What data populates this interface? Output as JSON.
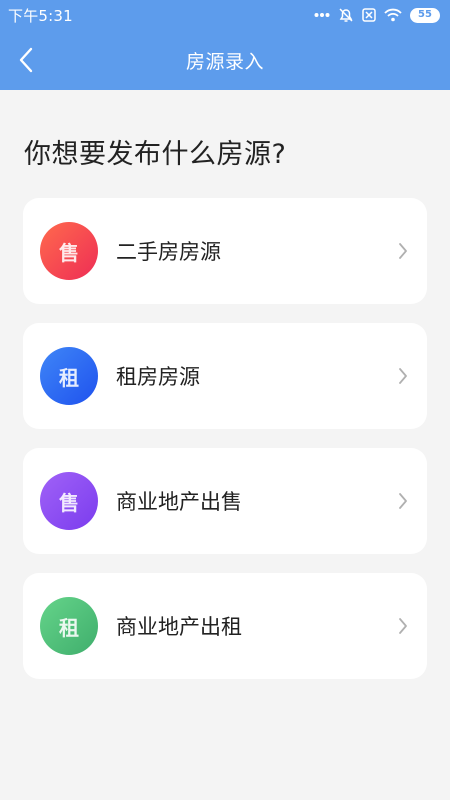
{
  "status_bar": {
    "time": "下午5:31",
    "battery": "55",
    "icons": [
      "more-dots-icon",
      "mute-icon",
      "no-sim-icon",
      "wifi-icon",
      "battery-icon"
    ]
  },
  "nav": {
    "title": "房源录入",
    "back_icon": "chevron-left-icon"
  },
  "question": "你想要发布什么房源?",
  "options": [
    {
      "badge": "售",
      "label": "二手房房源",
      "colors": [
        "#ff6a4d",
        "#ee2d55"
      ]
    },
    {
      "badge": "租",
      "label": "租房房源",
      "colors": [
        "#3f86f7",
        "#1f52ee"
      ]
    },
    {
      "badge": "售",
      "label": "商业地产出售",
      "colors": [
        "#a062f7",
        "#7b3cee"
      ]
    },
    {
      "badge": "租",
      "label": "商业地产出租",
      "colors": [
        "#65d48a",
        "#3fae6c"
      ]
    }
  ],
  "theme": {
    "header": "#5d9cec",
    "background": "#f4f4f4",
    "card": "#ffffff",
    "arrow": "#b0b0b0"
  }
}
